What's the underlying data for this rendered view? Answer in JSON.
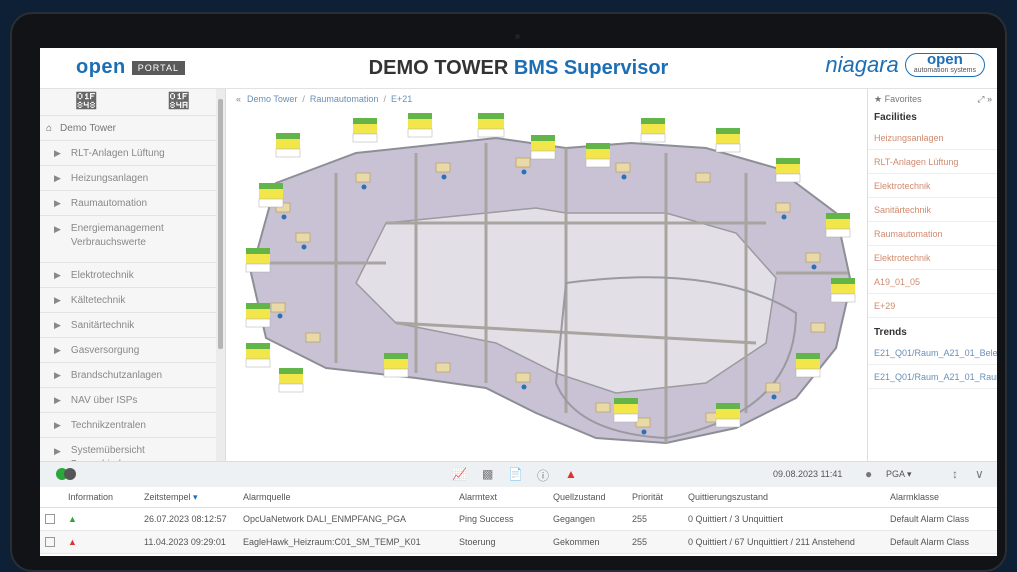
{
  "header": {
    "brand": "open",
    "brand_tag": "PORTAL",
    "title_main": "DEMO TOWER ",
    "title_accent": "BMS Supervisor",
    "logo_niagara": "niagara",
    "logo_oas_1": "open",
    "logo_oas_2": "automation systems"
  },
  "sidebar": {
    "home": "Demo Tower",
    "items": [
      {
        "label": "RLT-Anlagen Lüftung"
      },
      {
        "label": "Heizungsanlagen"
      },
      {
        "label": "Raumautomation"
      },
      {
        "label": "Energiemanagement Verbrauchswerte"
      },
      {
        "label": "Elektrotechnik"
      },
      {
        "label": "Kältetechnik"
      },
      {
        "label": "Sanitärtechnik"
      },
      {
        "label": "Gasversorgung"
      },
      {
        "label": "Brandschutzanlagen"
      },
      {
        "label": "NAV über ISPs"
      },
      {
        "label": "Technikzentralen"
      },
      {
        "label": "Systemübersicht Busverbindungen"
      }
    ]
  },
  "breadcrumb": [
    "Demo Tower",
    "Raumautomation",
    "E+21"
  ],
  "right_panel": {
    "favorites": "Favorites",
    "facilities_title": "Facilities",
    "facilities": [
      "Heizungsanlagen",
      "RLT-Anlagen Lüftung",
      "Elektrotechnik",
      "Sanitärtechnik",
      "Raumautomation",
      "Elektrotechnik",
      "A19_01_05",
      "E+29"
    ],
    "trends_title": "Trends",
    "trends": [
      "E21_Q01/Raum_A21_01_Bele",
      "E21_Q01/Raum_A21_01_Raum"
    ]
  },
  "status_bar": {
    "datetime": "09.08.2023 11:41",
    "user": "PGA"
  },
  "alarm_table": {
    "headers": [
      "Information",
      "Zeitstempel",
      "Alarmquelle",
      "Alarmtext",
      "Quellzustand",
      "Priorität",
      "Quittierungszustand",
      "Alarmklasse"
    ],
    "rows": [
      {
        "time": "26.07.2023 08:12:57",
        "source": "OpcUaNetwork DALI_ENMPFANG_PGA",
        "text": "Ping Success",
        "state": "Gegangen",
        "prio": "255",
        "ack": "0 Quittiert / 3 Unquittiert",
        "class": "Default Alarm Class"
      },
      {
        "time": "11.04.2023 09:29:01",
        "source": "EagleHawk_Heizraum:C01_SM_TEMP_K01",
        "text": "Stoerung",
        "state": "Gekommen",
        "prio": "255",
        "ack": "0 Quittiert / 67 Unquittiert / 211 Anstehend",
        "class": "Default Alarm Class"
      }
    ]
  },
  "colors": {
    "accent": "#1c6fb5",
    "link": "#6a8fb5",
    "alarm_green": "#2aa63a",
    "alarm_red": "#e03131",
    "tag_yellow": "#f3e64a",
    "tag_green": "#63b548"
  }
}
